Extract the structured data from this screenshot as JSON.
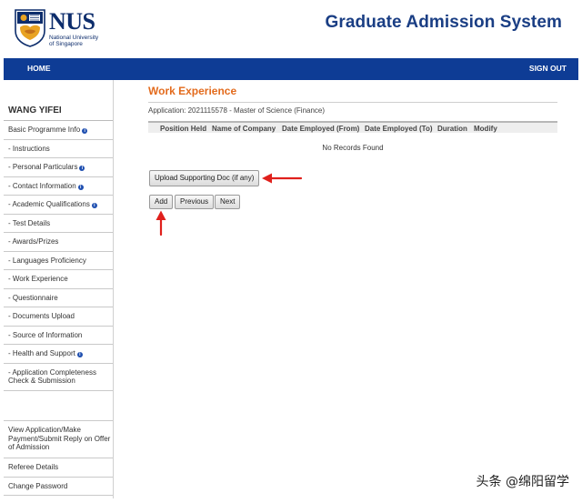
{
  "header": {
    "logo_text": "NUS",
    "logo_sub1": "National University",
    "logo_sub2": "of Singapore",
    "app_title": "Graduate Admission System"
  },
  "navbar": {
    "home_label": "HOME",
    "signout_label": "SIGN OUT"
  },
  "sidebar": {
    "user_name": "WANG YIFEI",
    "items": [
      {
        "label": "Basic Programme Info",
        "info": true
      },
      {
        "label": "- Instructions",
        "info": false
      },
      {
        "label": "- Personal Particulars",
        "info": true
      },
      {
        "label": "- Contact Information",
        "info": true
      },
      {
        "label": "- Academic Qualifications",
        "info": true
      },
      {
        "label": "- Test Details",
        "info": false
      },
      {
        "label": "- Awards/Prizes",
        "info": false
      },
      {
        "label": "- Languages Proficiency",
        "info": false
      },
      {
        "label": "- Work Experience",
        "info": false
      },
      {
        "label": "- Questionnaire",
        "info": false
      },
      {
        "label": "- Documents Upload",
        "info": false
      },
      {
        "label": "- Source of Information",
        "info": false
      },
      {
        "label": "- Health and Support",
        "info": true
      },
      {
        "label": "- Application Completeness Check & Submission",
        "info": false
      }
    ],
    "bottom_items": [
      {
        "label": "View Application/Make Payment/Submit Reply on Offer of Admission"
      },
      {
        "label": "Referee Details"
      },
      {
        "label": "Change Password"
      }
    ]
  },
  "main": {
    "section_title": "Work Experience",
    "application_info": "Application: 2021115578 - Master of Science (Finance)",
    "table": {
      "columns": [
        "Position Held",
        "Name of Company",
        "Date Employed (From)",
        "Date Employed (To)",
        "Duration",
        "Modify"
      ],
      "empty_text": "No Records Found"
    },
    "buttons": {
      "upload": "Upload Supporting Doc (if any)",
      "add": "Add",
      "previous": "Previous",
      "next": "Next"
    }
  },
  "icons": {
    "info": "info-icon",
    "arrow": "red-arrow-icon"
  },
  "colors": {
    "navbar": "#0e3c95",
    "title": "#1a3e84",
    "section_title": "#e36b1d",
    "arrow": "#e0201c"
  },
  "watermark": "头条 @绵阳留学"
}
